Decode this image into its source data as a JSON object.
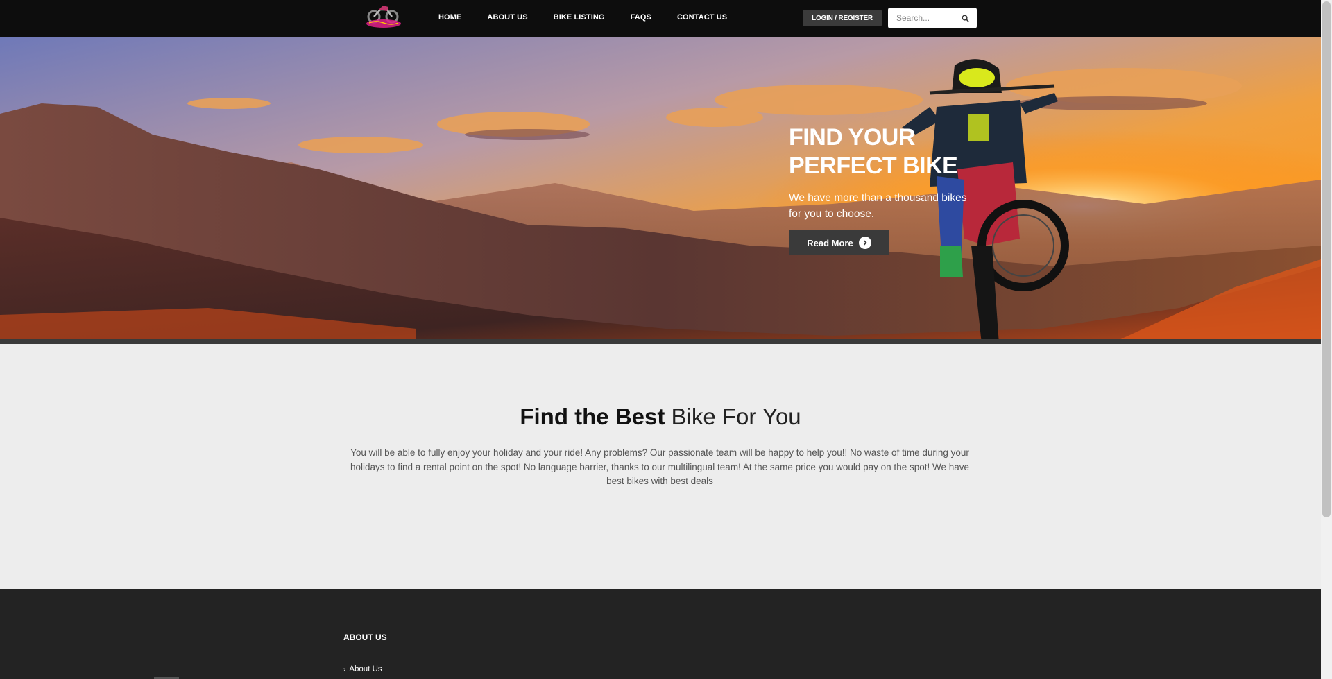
{
  "header": {
    "logo_alt": "logo",
    "nav": [
      {
        "label": "HOME"
      },
      {
        "label": "ABOUT US"
      },
      {
        "label": "BIKE LISTING"
      },
      {
        "label": "FAQS"
      },
      {
        "label": "CONTACT US"
      }
    ],
    "login_label": "LOGIN / REGISTER",
    "search_placeholder": "Search..."
  },
  "hero": {
    "title": "FIND YOUR PERFECT BIKE",
    "subtitle": "We have more than a thousand bikes for you to choose.",
    "button_label": "Read More"
  },
  "intro": {
    "title_bold": "Find the Best",
    "title_light": "Bike For You",
    "text": "You will be able to fully enjoy your holiday and your ride! Any problems? Our passionate team will be happy to help you!! No waste of time during your holidays to find a rental point on the spot! No language barrier, thanks to our multilingual team! At the same price you would pay on the spot! We have best bikes with best deals"
  },
  "footer": {
    "heading": "ABOUT US",
    "links": [
      {
        "label": "About Us"
      }
    ]
  },
  "colors": {
    "header_bg": "#0d0d0d",
    "button_bg": "#3a3a3a",
    "page_bg": "#ededed",
    "footer_bg": "#232323",
    "logo_accent": "#e0218a"
  }
}
